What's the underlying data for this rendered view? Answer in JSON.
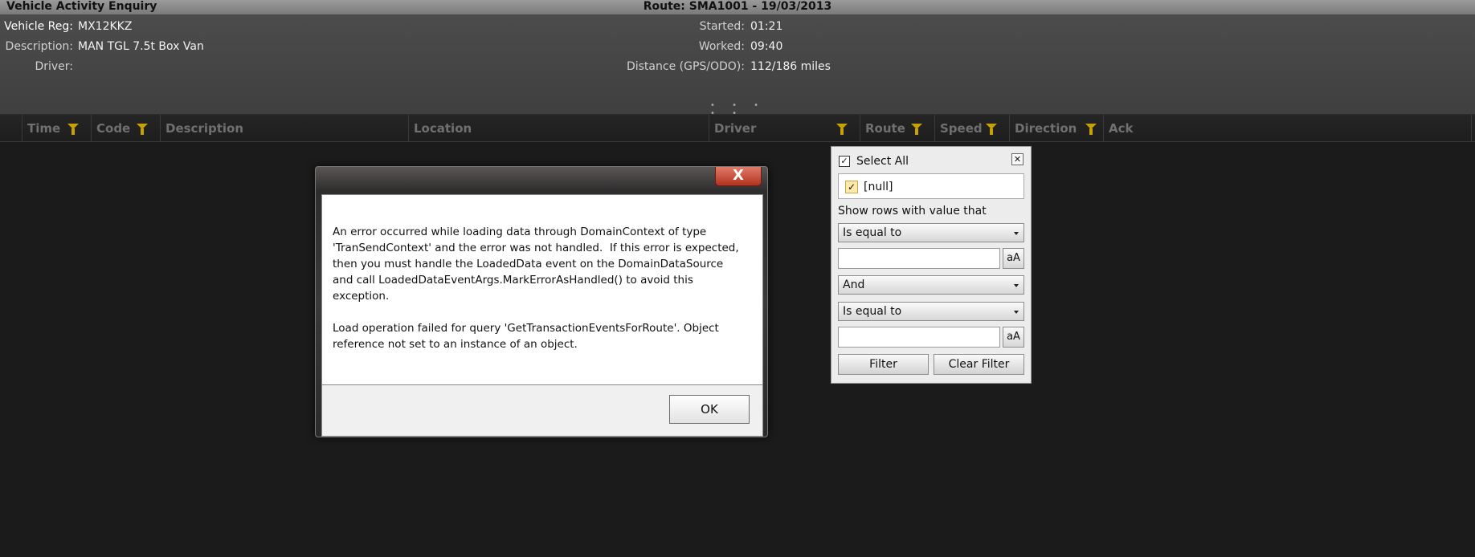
{
  "titlebar": {
    "app_title": "Vehicle Activity Enquiry",
    "route_title": "Route: SMA1001 - 19/03/2013"
  },
  "vehicle": {
    "reg_label": "Vehicle Reg:",
    "reg_value": "MX12KKZ",
    "description_label": "Description:",
    "description_value": "MAN TGL 7.5t Box Van",
    "driver_label": "Driver:",
    "driver_value": ""
  },
  "route_stats": {
    "started_label": "Started:",
    "started_value": "01:21",
    "worked_label": "Worked:",
    "worked_value": "09:40",
    "distance_label": "Distance (GPS/ODO):",
    "distance_value": "112/186 miles"
  },
  "grid": {
    "columns": [
      "Time",
      "Code",
      "Description",
      "Location",
      "Driver",
      "Route",
      "Speed",
      "Direction",
      "Ack"
    ],
    "splitter_dots": "• • • • •"
  },
  "error_dialog": {
    "close_glyph": "X",
    "message": "An error occurred while loading data through DomainContext of type\n'TranSendContext' and the error was not handled.  If this error is expected,\nthen you must handle the LoadedData event on the DomainDataSource\nand call LoadedDataEventArgs.MarkErrorAsHandled() to avoid this\nexception.\n\nLoad operation failed for query 'GetTransactionEventsForRoute'. Object\nreference not set to an instance of an object.",
    "ok_label": "OK"
  },
  "filter_popup": {
    "select_all_label": "Select All",
    "select_all_checked": true,
    "null_item_label": "[null]",
    "null_item_checked": true,
    "condition_caption": "Show rows with value that",
    "operator_1": "Is equal to",
    "value_1": "",
    "logical_operator": "And",
    "operator_2": "Is equal to",
    "value_2": "",
    "case_label": "aA",
    "filter_button": "Filter",
    "clear_filter_button": "Clear Filter",
    "close_glyph": "✕"
  },
  "colors": {
    "filter_icon": "#c8a200",
    "dialog_close": "#c0392b",
    "background": "#1b1b1b"
  }
}
